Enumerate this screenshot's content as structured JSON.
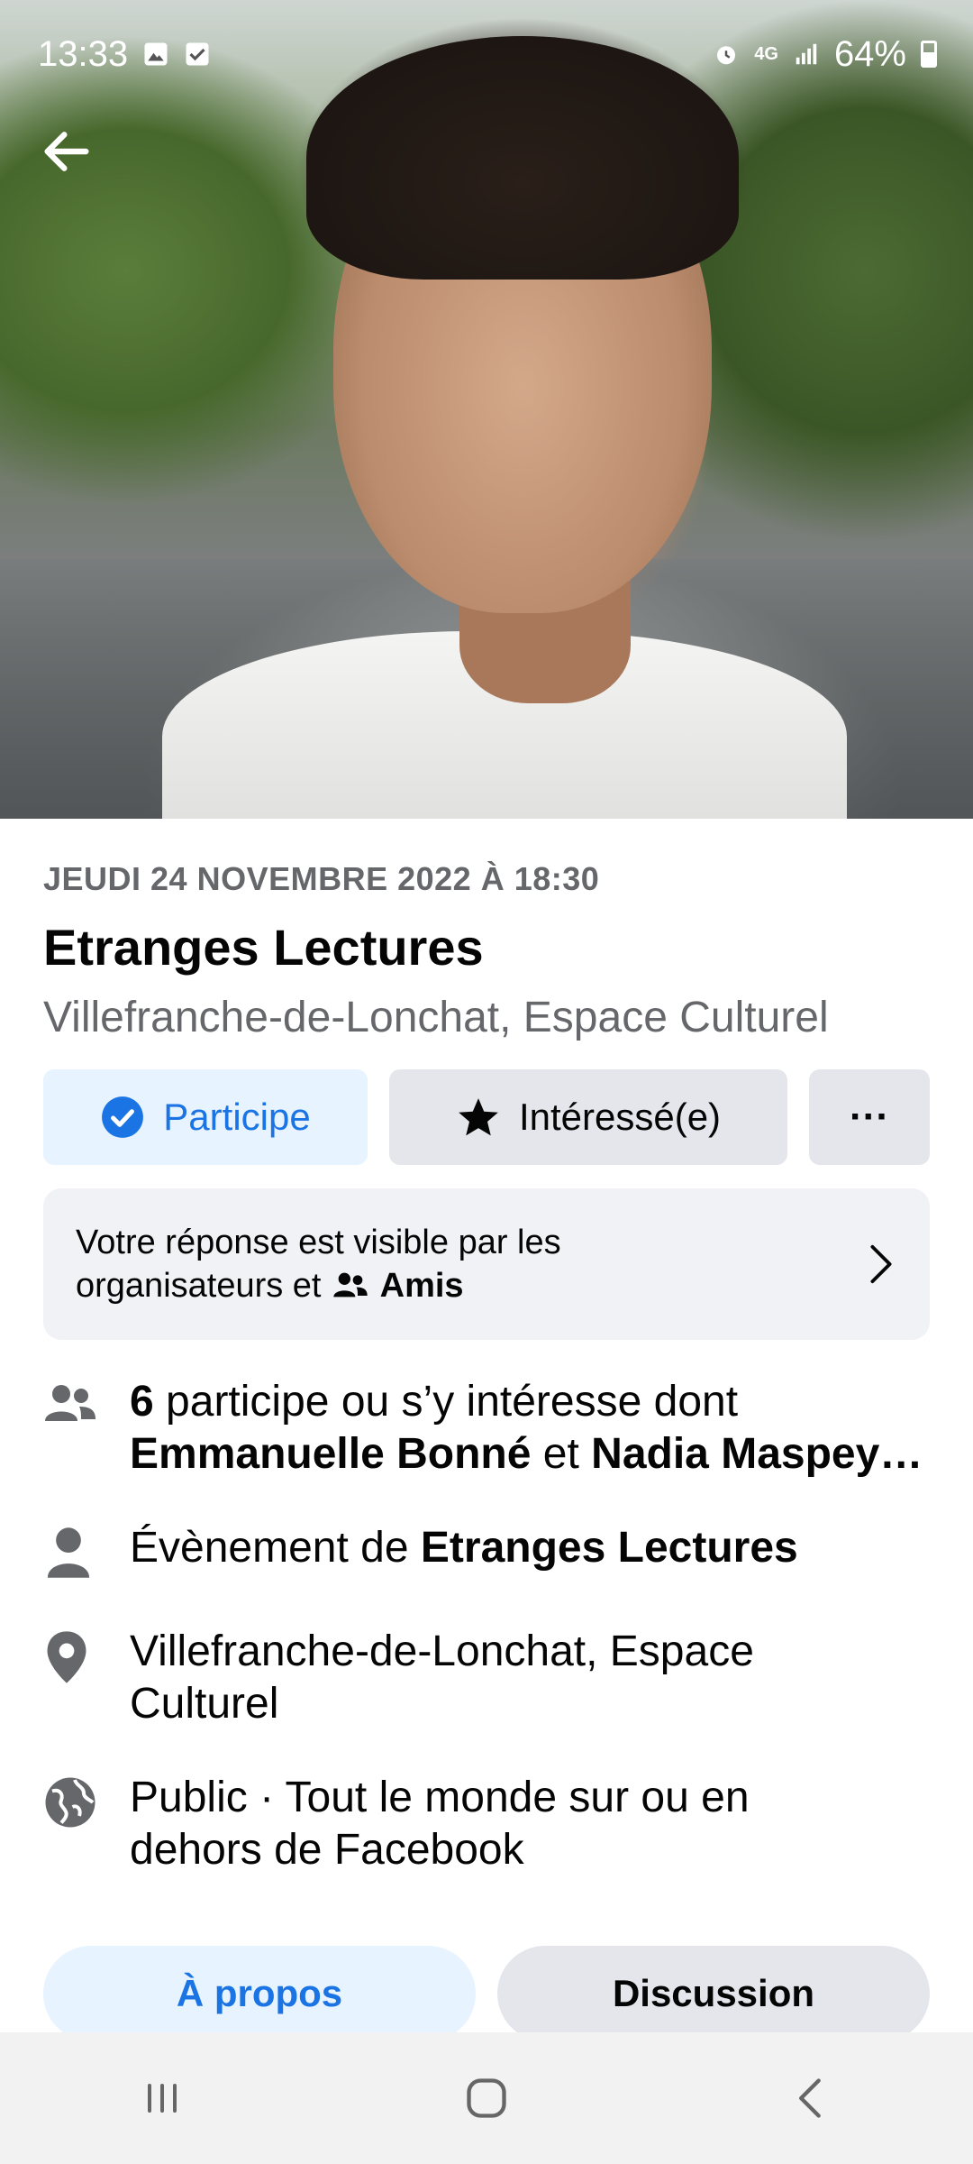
{
  "status_bar": {
    "time": "13:33",
    "network": "4G",
    "battery": "64%",
    "icons": [
      "image-icon",
      "check-box-icon",
      "alarm-icon",
      "signal-icon",
      "battery-icon"
    ]
  },
  "event": {
    "date": "JEUDI 24 NOVEMBRE 2022 À 18:30",
    "title": "Etranges Lectures",
    "location_subtitle": "Villefranche-de-Lonchat, Espace Culturel"
  },
  "actions": {
    "going_label": "Participe",
    "interested_label": "Intéressé(e)",
    "more_label": "···"
  },
  "notice": {
    "line1": "Votre réponse est visible par les",
    "line2_prefix": "organisateurs et",
    "audience": "Amis"
  },
  "info": {
    "participants_count": "6",
    "participants_text": "participe ou s’y intéresse dont",
    "friend1": "Emmanuelle Bonné",
    "conjunction": "et",
    "friend2": "Nadia Maspey…",
    "organizer_prefix": "Évènement de",
    "organizer": "Etranges Lectures",
    "place_line1": "Villefranche-de-Lonchat, Espace",
    "place_line2": "Culturel",
    "privacy_line1": "Public · Tout le monde sur ou en",
    "privacy_line2": "dehors de Facebook"
  },
  "tabs": {
    "about": "À propos",
    "discussion": "Discussion"
  },
  "colors": {
    "accent": "#1b74e4",
    "accent_bg": "#e7f3ff",
    "button_bg": "#e4e6eb",
    "secondary_text": "#65676b",
    "notice_bg": "#f0f2f5"
  }
}
